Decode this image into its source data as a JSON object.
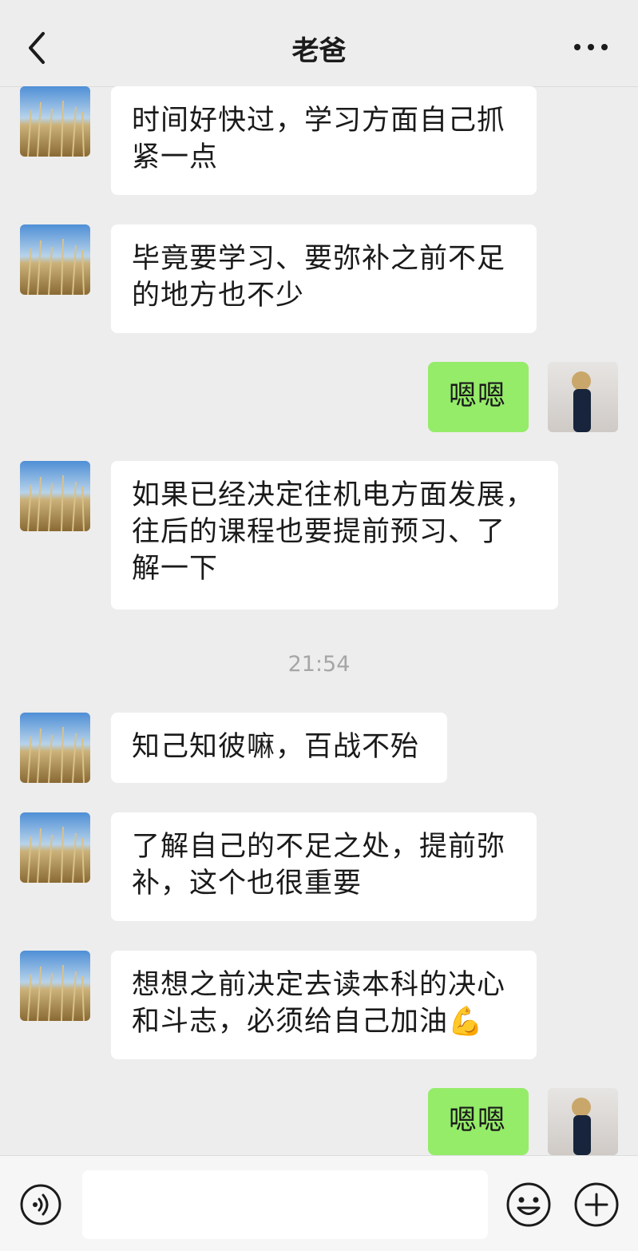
{
  "header": {
    "title": "老爸"
  },
  "messages": [
    {
      "side": "left",
      "text_lines": [
        "时间好快过，学习方面自己抓",
        "紧一点"
      ]
    },
    {
      "side": "left",
      "text_lines": [
        "毕竟要学习、要弥补之前不足",
        "的地方也不少"
      ]
    },
    {
      "side": "right",
      "text_lines": [
        "嗯嗯"
      ]
    },
    {
      "side": "left",
      "text_lines": [
        "如果已经决定往机电方面发展，",
        "往后的课程也要提前预习、了",
        "解一下"
      ]
    },
    {
      "side": "left",
      "text_lines": [
        "知己知彼嘛，百战不殆"
      ]
    },
    {
      "side": "left",
      "text_lines": [
        "了解自己的不足之处，提前弥",
        "补，这个也很重要"
      ]
    },
    {
      "side": "left",
      "text_lines": [
        "想想之前决定去读本科的决心",
        "和斗志，必须给自己加油💪"
      ]
    },
    {
      "side": "right",
      "text_lines": [
        "嗯嗯"
      ]
    }
  ],
  "timestamp": "21:54",
  "icons": {
    "back": "chevron-left-icon",
    "more": "more-dots-icon",
    "voice": "voice-icon",
    "emoji": "emoji-icon",
    "plus": "plus-icon"
  },
  "colors": {
    "my_bubble": "#95ec69",
    "their_bubble": "#ffffff",
    "background": "#ededed"
  }
}
